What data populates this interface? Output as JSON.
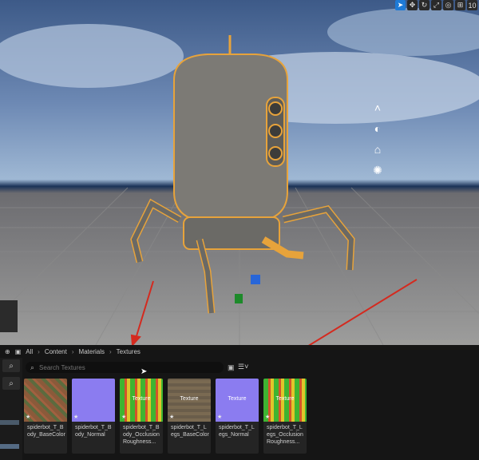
{
  "viewport": {
    "toolbar": {
      "camera_speed": "10"
    }
  },
  "content_browser": {
    "breadcrumb": [
      "All",
      "Content",
      "Materials",
      "Textures"
    ],
    "search": {
      "placeholder": "Search Textures",
      "value": ""
    },
    "assets": [
      {
        "name": "spiderbot_T_Body_BaseColor",
        "thumb_label": "",
        "thumb": "basecolor-body"
      },
      {
        "name": "spiderbot_T_Body_Normal",
        "thumb_label": "",
        "thumb": "normal"
      },
      {
        "name": "spiderbot_T_Body_Occlusion Roughness...",
        "thumb_label": "Texture",
        "thumb": "orm"
      },
      {
        "name": "spiderbot_T_Legs_BaseColor",
        "thumb_label": "Texture",
        "thumb": "basecolor-legs"
      },
      {
        "name": "spiderbot_T_Legs_Normal",
        "thumb_label": "Texture",
        "thumb": "normal"
      },
      {
        "name": "spiderbot_T_Legs_Occlusion Roughness...",
        "thumb_label": "Texture",
        "thumb": "orm"
      }
    ]
  },
  "colors": {
    "annotation_arrows": "#d42a1f",
    "selection_outline": "#e7a33b",
    "accent": "#1e7ad6"
  }
}
